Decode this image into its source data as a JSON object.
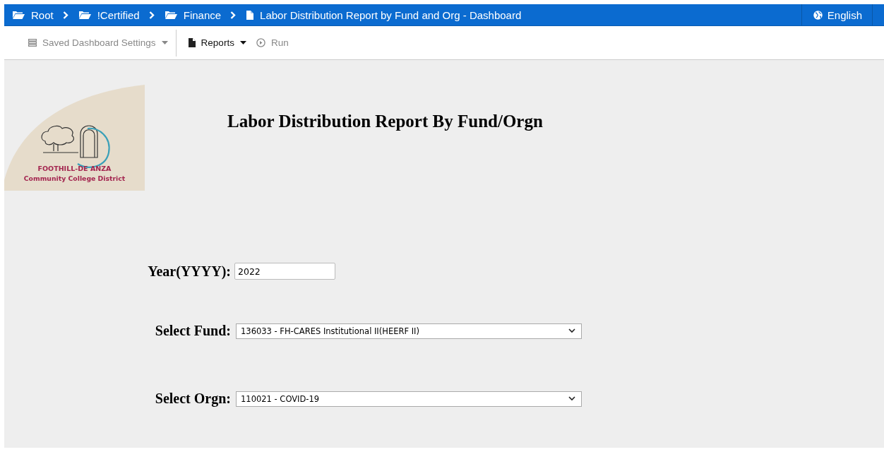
{
  "breadcrumbs": [
    {
      "label": "Root",
      "kind": "folder"
    },
    {
      "label": "!Certified",
      "kind": "folder"
    },
    {
      "label": "Finance",
      "kind": "folder"
    },
    {
      "label": "Labor Distribution Report by Fund and Org - Dashboard",
      "kind": "report"
    }
  ],
  "language": "English",
  "toolbar": [
    {
      "label": "Saved Dashboard Settings",
      "kind": "settings",
      "disabled": true,
      "dropdown": true
    },
    {
      "label": "Reports",
      "kind": "reports",
      "disabled": false,
      "dropdown": true
    },
    {
      "label": "Run",
      "kind": "run",
      "disabled": true,
      "dropdown": false
    }
  ],
  "logo": {
    "line_1": "FOOTHILL-DE ANZA",
    "line_2": "Community College District"
  },
  "title": "Labor Distribution Report By Fund/Orgn",
  "fields": [
    {
      "label": "Year(YYYY):",
      "kind": "text",
      "value": "2022"
    },
    {
      "label": "Select Fund:",
      "kind": "select",
      "value": "136033 - FH-CARES Institutional II(HEERF II)"
    },
    {
      "label": "Select Orgn:",
      "kind": "select",
      "value": "110021 - COVID-19"
    }
  ]
}
